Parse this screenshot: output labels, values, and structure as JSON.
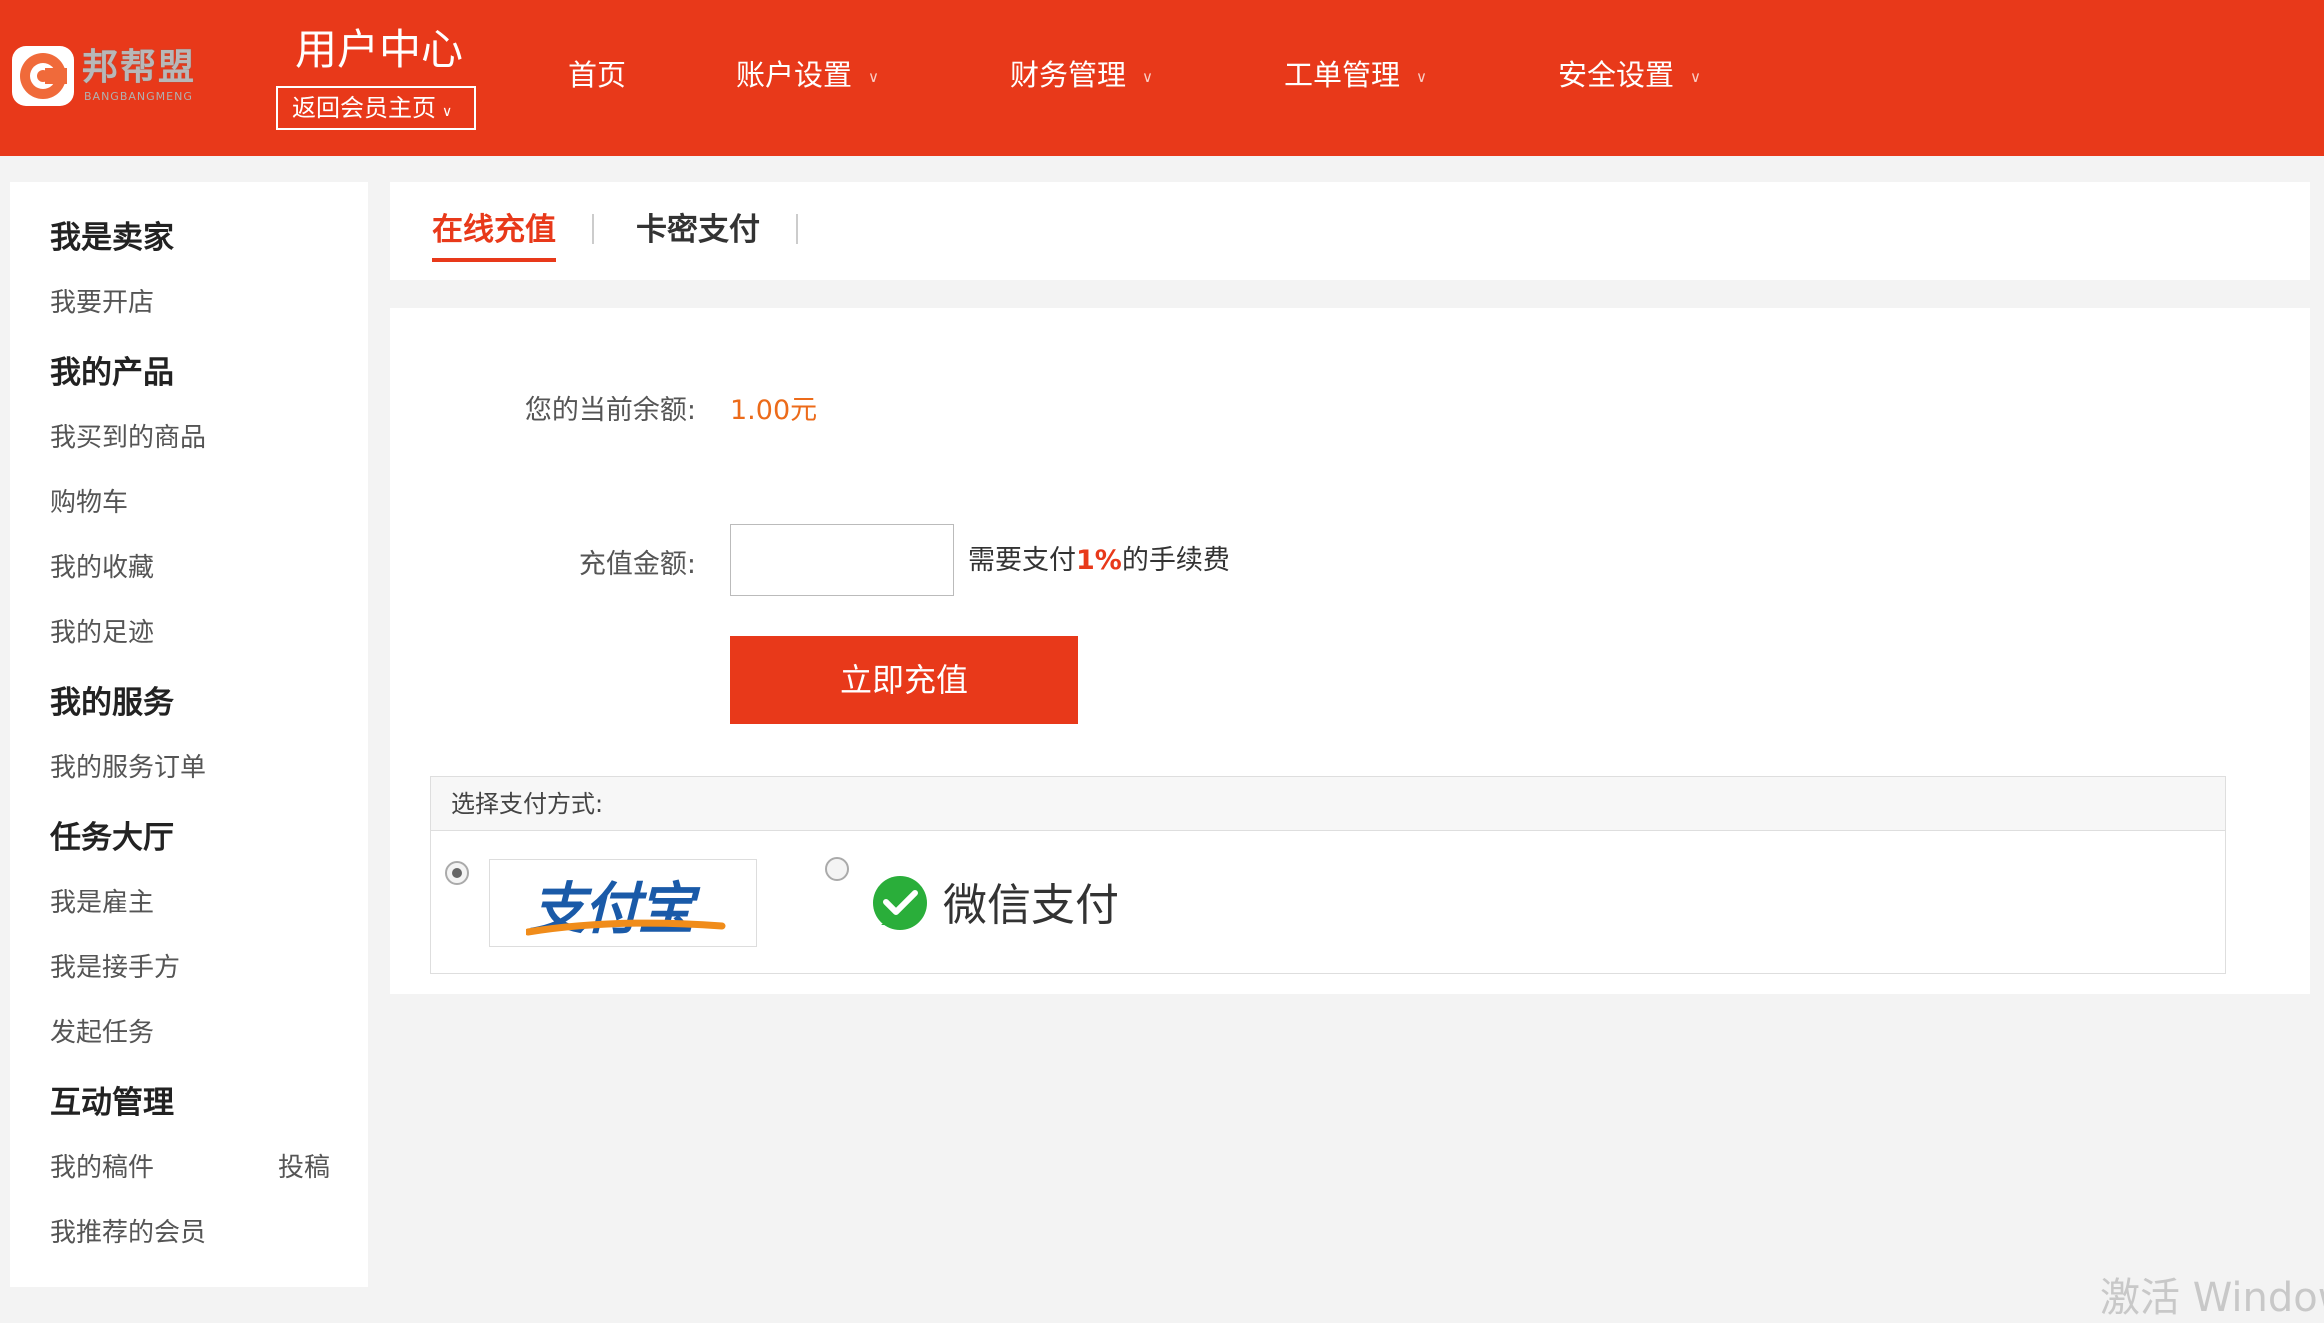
{
  "header": {
    "logo_text": "邦帮盟",
    "logo_sub": "BANGBANGMENG",
    "title": "用户中心",
    "back_link": "返回会员主页",
    "nav": [
      {
        "label": "首页",
        "has_dropdown": false
      },
      {
        "label": "账户设置",
        "has_dropdown": true
      },
      {
        "label": "财务管理",
        "has_dropdown": true
      },
      {
        "label": "工单管理",
        "has_dropdown": true
      },
      {
        "label": "安全设置",
        "has_dropdown": true
      }
    ],
    "dropdown_icon": "chevron-down-icon"
  },
  "sidebar": {
    "sections": [
      {
        "heading": "我是卖家",
        "links": [
          "我要开店"
        ]
      },
      {
        "heading": "我的产品",
        "links": [
          "我买到的商品",
          "购物车",
          "我的收藏",
          "我的足迹"
        ]
      },
      {
        "heading": "我的服务",
        "links": [
          "我的服务订单"
        ]
      },
      {
        "heading": "任务大厅",
        "links": [
          "我是雇主",
          "我是接手方",
          "发起任务"
        ]
      },
      {
        "heading": "互动管理",
        "links": [
          "我的稿件",
          "我推荐的会员"
        ],
        "extra": "投稿"
      }
    ]
  },
  "tabs": [
    {
      "label": "在线充值",
      "active": true
    },
    {
      "label": "卡密支付",
      "active": false
    }
  ],
  "recharge": {
    "balance_label": "您的当前余额:",
    "balance_value": "1.00元",
    "amount_label": "充值金额:",
    "amount_value": "",
    "fee_prefix": "需要支付",
    "fee_pct": "1%",
    "fee_suffix": "的手续费",
    "submit_label": "立即充值"
  },
  "payment": {
    "heading": "选择支付方式:",
    "options": [
      {
        "name": "支付宝",
        "selected": true
      },
      {
        "name": "微信支付",
        "selected": false
      }
    ]
  },
  "watermark": "激活 Windows",
  "colors": {
    "brand": "#e8391a",
    "balance": "#ec6b1a",
    "alipay_blue": "#1a5aa8",
    "wechat_green": "#2aae3a"
  }
}
